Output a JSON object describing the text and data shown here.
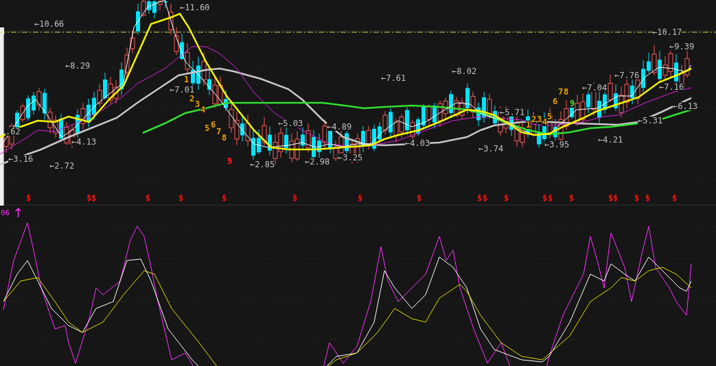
{
  "price_chart": {
    "price_labels": [
      {
        "text": "←10.66"
      },
      {
        "text": "←11.60"
      },
      {
        "text": "←8.29"
      },
      {
        "text": "←7.01"
      },
      {
        "text": "←4.13"
      },
      {
        "text": ".62"
      },
      {
        "text": "←3.16"
      },
      {
        "text": "←2.72"
      },
      {
        "text": "←5.03"
      },
      {
        "text": "←4.89"
      },
      {
        "text": "←2.85"
      },
      {
        "text": "←2.98"
      },
      {
        "text": "←3.25"
      },
      {
        "text": "←7.61"
      },
      {
        "text": "←4.03"
      },
      {
        "text": "←8.02"
      },
      {
        "text": "←5.71"
      },
      {
        "text": "←3.74"
      },
      {
        "text": "←3.95"
      },
      {
        "text": "←4.21"
      },
      {
        "text": "←7.04"
      },
      {
        "text": "←7.76"
      },
      {
        "text": "←10.17"
      },
      {
        "text": "←9.39"
      },
      {
        "text": "←7.16"
      },
      {
        "text": "←6.13"
      },
      {
        "text": "←5.31"
      }
    ],
    "sequence_markers": [
      {
        "text": "1",
        "color": "#e8a000"
      },
      {
        "text": "2",
        "color": "#e8a000"
      },
      {
        "text": "3",
        "color": "#e8a000"
      },
      {
        "text": "4",
        "color": "#e8a000"
      },
      {
        "text": "5",
        "color": "#e8a000"
      },
      {
        "text": "6",
        "color": "#e8a000"
      },
      {
        "text": "7",
        "color": "#e8a000"
      },
      {
        "text": "8",
        "color": "#e8a000"
      },
      {
        "text": "9",
        "color": "#ff2020"
      },
      {
        "text": "1",
        "color": "#e8a000"
      },
      {
        "text": "2",
        "color": "#e8a000"
      },
      {
        "text": "3",
        "color": "#e8a000"
      },
      {
        "text": "4",
        "color": "#e8a000"
      },
      {
        "text": "5",
        "color": "#e8a000"
      },
      {
        "text": "6",
        "color": "#e8a000"
      },
      {
        "text": "7",
        "color": "#e8a000"
      },
      {
        "text": "8",
        "color": "#e8a000"
      },
      {
        "text": "9",
        "color": "#40e020"
      }
    ],
    "signal_markers": [
      {
        "text": "$"
      },
      {
        "text": "$"
      },
      {
        "text": "$"
      },
      {
        "text": "$"
      },
      {
        "text": "$"
      },
      {
        "text": "$"
      },
      {
        "text": "$"
      },
      {
        "text": "$"
      },
      {
        "text": "$"
      },
      {
        "text": "$"
      },
      {
        "text": "$"
      },
      {
        "text": "$"
      },
      {
        "text": "$"
      },
      {
        "text": "$"
      },
      {
        "text": "$"
      },
      {
        "text": "$"
      },
      {
        "text": "$"
      },
      {
        "text": "$"
      },
      {
        "text": "$"
      },
      {
        "text": "$"
      }
    ]
  },
  "indicator_chart": {
    "label": "06"
  }
}
